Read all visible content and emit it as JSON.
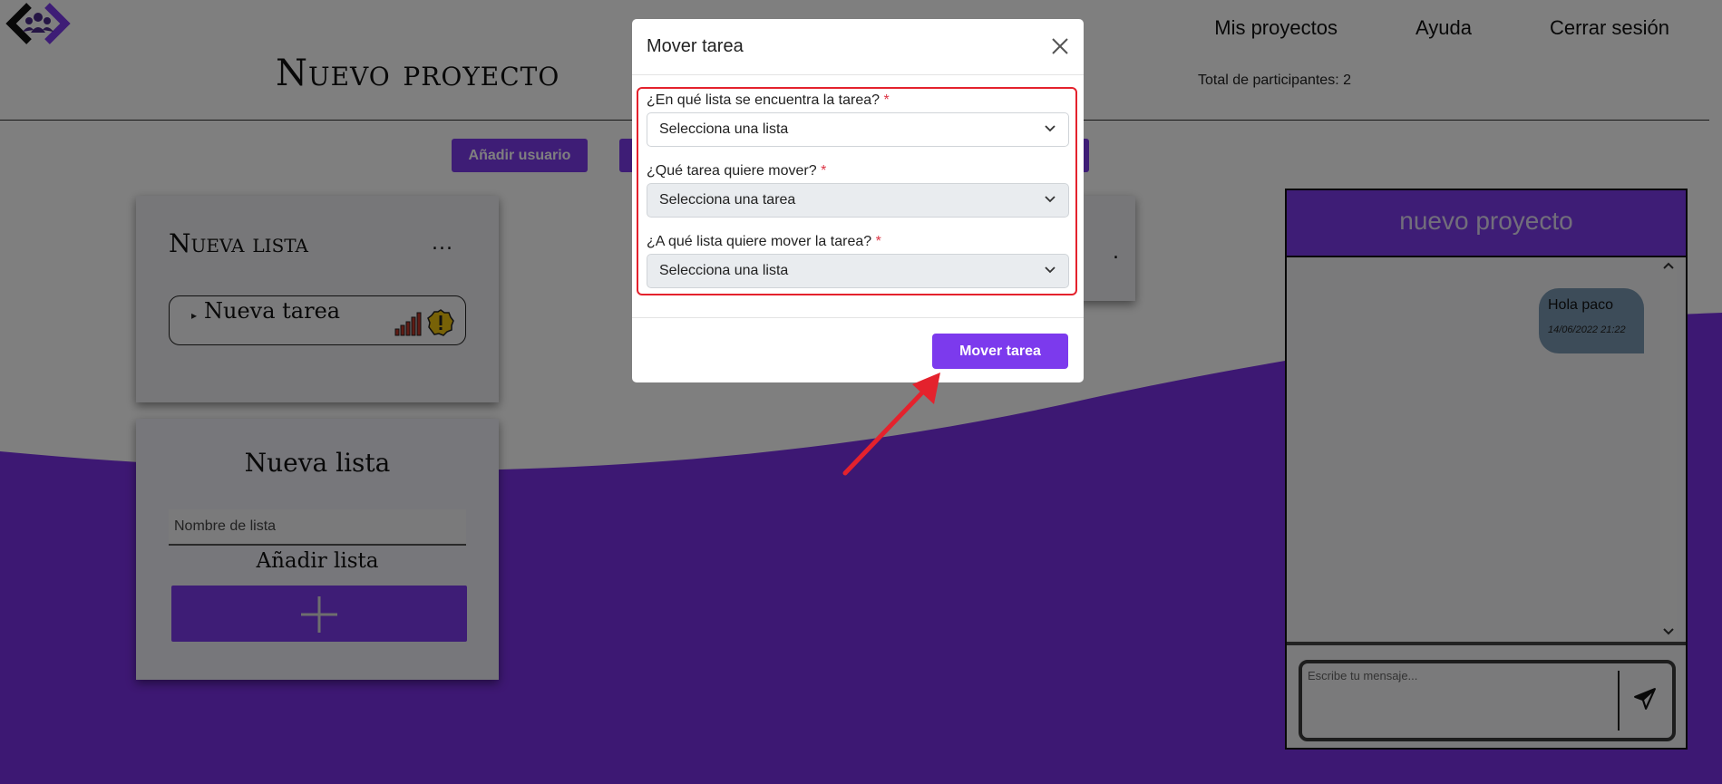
{
  "header": {
    "title": "Nuevo proyecto",
    "nav": [
      "Mis proyectos",
      "Ayuda",
      "Cerrar sesión"
    ],
    "participants": "Total de participantes: 2"
  },
  "toolbar": {
    "add_user_label": "Añadir usuario"
  },
  "lists": [
    {
      "title": "Nueva lista",
      "menu": "...",
      "tasks": [
        {
          "name": "Nueva tarea",
          "priority_icon": "signal-bars-icon",
          "status_icon": "warning-icon"
        }
      ]
    }
  ],
  "partial_card": {
    "menu": "."
  },
  "new_list": {
    "title": "Nueva lista",
    "name_placeholder": "Nombre de lista",
    "add_label": "Añadir lista",
    "add_icon": "plus-icon"
  },
  "chat": {
    "title": "nuevo proyecto",
    "messages": [
      {
        "text": "Hola paco",
        "time": "14/06/2022 21:22"
      }
    ],
    "input_placeholder": "Escribe tu mensaje...",
    "send_icon": "send-icon"
  },
  "modal": {
    "title": "Mover tarea",
    "fields": [
      {
        "label": "¿En qué lista se encuentra la tarea?",
        "required_mark": "*",
        "value": "Selecciona una lista"
      },
      {
        "label": "¿Qué tarea quiere mover?",
        "required_mark": "*",
        "value": "Selecciona una tarea"
      },
      {
        "label": "¿A qué lista quiere mover la tarea?",
        "required_mark": "*",
        "value": "Selecciona una lista"
      }
    ],
    "submit_label": "Mover tarea"
  },
  "colors": {
    "accent": "#7c3aed",
    "wave": "#7b30e6",
    "annotation": "#e4222d",
    "chat_bubble": "#7a99b3"
  }
}
